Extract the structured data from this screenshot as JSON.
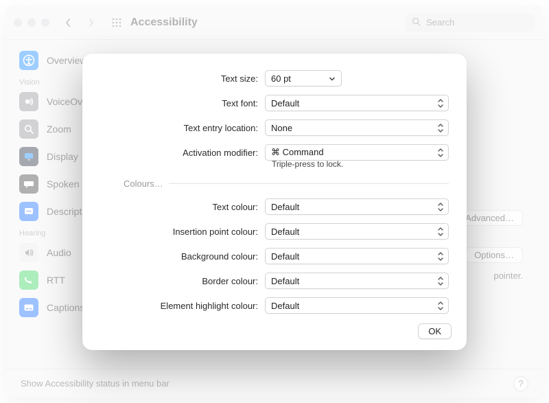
{
  "window": {
    "title": "Accessibility",
    "search_placeholder": "Search"
  },
  "sidebar": {
    "items": [
      {
        "label": "Overview"
      }
    ],
    "group_vision": "Vision",
    "vision_items": [
      {
        "label": "VoiceOver"
      },
      {
        "label": "Zoom"
      },
      {
        "label": "Display"
      },
      {
        "label": "Spoken Content"
      },
      {
        "label": "Descriptions"
      }
    ],
    "group_hearing": "Hearing",
    "hearing_items": [
      {
        "label": "Audio"
      },
      {
        "label": "RTT"
      },
      {
        "label": "Captions"
      }
    ]
  },
  "bg": {
    "advanced_btn": "Advanced…",
    "options_btn": "Options…",
    "pointer_text": "pointer."
  },
  "footer": {
    "status": "Show Accessibility status in menu bar",
    "help": "?"
  },
  "sheet": {
    "labels": {
      "text_size": "Text size:",
      "text_font": "Text font:",
      "entry_location": "Text entry location:",
      "activation_modifier": "Activation modifier:",
      "hint": "Triple-press to lock.",
      "section_colours": "Colours…",
      "text_colour": "Text colour:",
      "insertion_colour": "Insertion point colour:",
      "bg_colour": "Background colour:",
      "border_colour": "Border colour:",
      "highlight_colour": "Element highlight colour:"
    },
    "values": {
      "text_size": "60 pt",
      "text_font": "Default",
      "entry_location": "None",
      "activation_modifier": "⌘ Command",
      "text_colour": "Default",
      "insertion_colour": "Default",
      "bg_colour": "Default",
      "border_colour": "Default",
      "highlight_colour": "Default"
    },
    "ok": "OK"
  }
}
